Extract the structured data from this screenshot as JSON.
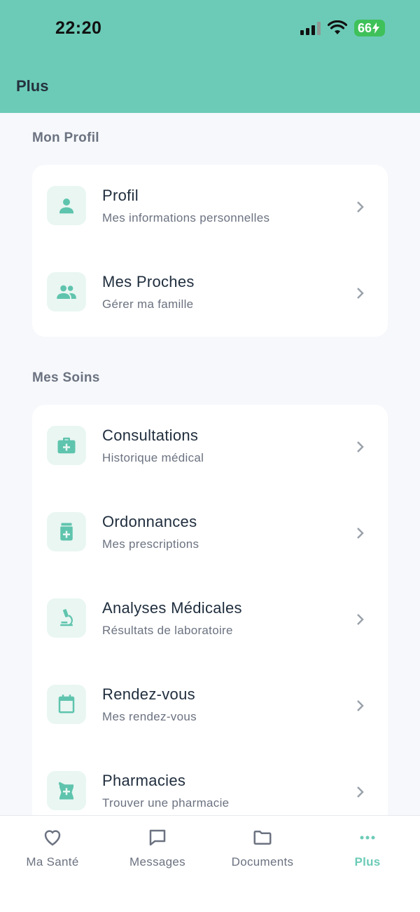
{
  "status": {
    "time": "22:20",
    "battery": "66"
  },
  "header": {
    "title": "Plus"
  },
  "sections": [
    {
      "title": "Mon Profil",
      "items": [
        {
          "title": "Profil",
          "subtitle": "Mes informations personnelles",
          "icon": "person-icon"
        },
        {
          "title": "Mes Proches",
          "subtitle": "Gérer ma famille",
          "icon": "group-icon"
        }
      ]
    },
    {
      "title": "Mes Soins",
      "items": [
        {
          "title": "Consultations",
          "subtitle": "Historique médical",
          "icon": "medical-bag-icon"
        },
        {
          "title": "Ordonnances",
          "subtitle": "Mes prescriptions",
          "icon": "pill-bottle-icon"
        },
        {
          "title": "Analyses Médicales",
          "subtitle": "Résultats de laboratoire",
          "icon": "microscope-icon"
        },
        {
          "title": "Rendez-vous",
          "subtitle": "Mes rendez-vous",
          "icon": "calendar-icon"
        },
        {
          "title": "Pharmacies",
          "subtitle": "Trouver une pharmacie",
          "icon": "pharmacy-mortar-icon"
        }
      ]
    }
  ],
  "tabs": [
    {
      "label": "Ma Santé",
      "icon": "heart-icon"
    },
    {
      "label": "Messages",
      "icon": "message-icon"
    },
    {
      "label": "Documents",
      "icon": "folder-icon"
    },
    {
      "label": "Plus",
      "icon": "more-dots-icon",
      "active": true
    }
  ],
  "colors": {
    "accent": "#6ccbb7",
    "icon_bg": "#e9f6f2",
    "battery": "#3fc15a"
  }
}
